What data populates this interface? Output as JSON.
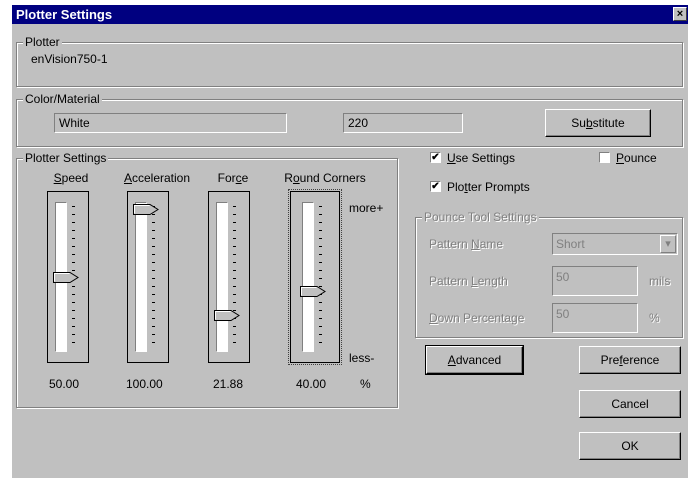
{
  "window": {
    "title": "Plotter Settings",
    "close_glyph": "×"
  },
  "plotter_group": {
    "label": "Plotter",
    "name": "enVision750-1"
  },
  "color_group": {
    "label": "Color/Material",
    "material": "White",
    "value": "220",
    "substitute_pre": "Su",
    "substitute_ul": "b",
    "substitute_post": "stitute"
  },
  "settings_group": {
    "label": "Plotter Settings",
    "sliders": [
      {
        "pre": "",
        "ul": "S",
        "post": "peed",
        "value_text": "50.00",
        "level": 0.5
      },
      {
        "pre": "",
        "ul": "A",
        "post": "cceleration",
        "value_text": "100.00",
        "level": 1.0
      },
      {
        "pre": "For",
        "ul": "c",
        "post": "e",
        "value_text": "21.88",
        "level": 0.2188
      },
      {
        "pre": "R",
        "ul": "o",
        "post": "und Corners",
        "value_text": "40.00",
        "level": 0.4
      }
    ],
    "more_label": "more+",
    "less_label": "less-",
    "unit_label": "%"
  },
  "options": {
    "use_settings_ul": "U",
    "use_settings_post": "se Settings",
    "use_settings_checked": true,
    "pounce_ul": "P",
    "pounce_post": "ounce",
    "pounce_checked": false,
    "plotter_prompts_pre": "Plo",
    "plotter_prompts_ul": "t",
    "plotter_prompts_post": "ter Prompts",
    "plotter_prompts_checked": true,
    "check_glyph": "✔"
  },
  "pounce_group": {
    "label": "Pounce Tool Settings",
    "pattern_name_pre": "Pattern ",
    "pattern_name_ul": "N",
    "pattern_name_post": "ame",
    "pattern_name_value": "Short",
    "pattern_length_pre": "Pattern ",
    "pattern_length_ul": "L",
    "pattern_length_post": "ength",
    "pattern_length_value": "50",
    "pattern_length_unit": "mils",
    "down_pct_ul": "D",
    "down_pct_post": "own Percentage",
    "down_pct_value": "50",
    "down_pct_unit": "%",
    "dropdown_glyph": "▾"
  },
  "buttons": {
    "advanced_ul": "A",
    "advanced_post": "dvanced",
    "preference_pre": "Pre",
    "preference_ul": "f",
    "preference_post": "erence",
    "cancel": "Cancel",
    "ok": "OK"
  }
}
